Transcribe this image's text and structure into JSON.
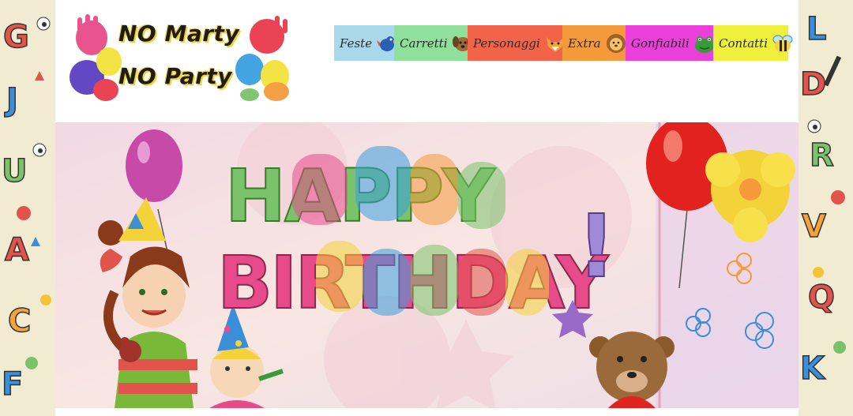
{
  "logo": {
    "line1": "NO Marty",
    "line2": "NO Party"
  },
  "nav": {
    "items": [
      {
        "label": "Feste",
        "color": "#a8d8ea",
        "icon": "bird-icon"
      },
      {
        "label": "Carretti",
        "color": "#8fe09a",
        "icon": "dog-icon"
      },
      {
        "label": "Personaggi",
        "color": "#f26449",
        "icon": "fox-icon"
      },
      {
        "label": "Extra",
        "color": "#f59a3a",
        "icon": "lion-icon"
      },
      {
        "label": "Gonfiabili",
        "color": "#ea3fd9",
        "icon": "frog-icon"
      },
      {
        "label": "Contatti",
        "color": "#eef03c",
        "icon": "bee-icon"
      }
    ]
  },
  "banner": {
    "title_line1": "HAPPY",
    "title_line2": "BIRTHDAY",
    "exclamation": "!"
  },
  "colors": {
    "page_bg": "#ffffff",
    "banner_bg": "#f7e6e4"
  }
}
